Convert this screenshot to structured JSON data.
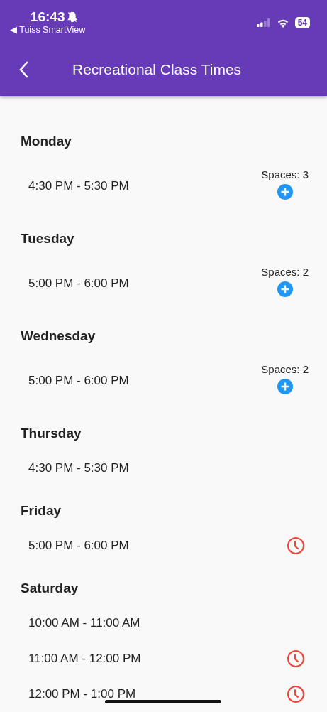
{
  "status_bar": {
    "time": "16:43",
    "back_app": "◀ Tuiss SmartView",
    "battery": "54"
  },
  "app_bar": {
    "title": "Recreational Class Times"
  },
  "days": [
    {
      "name": "Monday",
      "slots": [
        {
          "kind": "spaces",
          "time": "4:30 PM - 5:30 PM",
          "spaces": "Spaces: 3"
        }
      ]
    },
    {
      "name": "Tuesday",
      "slots": [
        {
          "kind": "spaces",
          "time": "5:00 PM - 6:00 PM",
          "spaces": "Spaces: 2"
        }
      ]
    },
    {
      "name": "Wednesday",
      "slots": [
        {
          "kind": "spaces",
          "time": "5:00 PM - 6:00 PM",
          "spaces": "Spaces: 2"
        }
      ]
    },
    {
      "name": "Thursday",
      "slots": [
        {
          "kind": "plain",
          "time": "4:30 PM - 5:30 PM"
        }
      ]
    },
    {
      "name": "Friday",
      "slots": [
        {
          "kind": "waitlist",
          "time": "5:00 PM - 6:00 PM"
        }
      ]
    },
    {
      "name": "Saturday",
      "slots": [
        {
          "kind": "plain",
          "time": "10:00 AM - 11:00 AM"
        },
        {
          "kind": "waitlist",
          "time": "11:00 AM - 12:00 PM"
        },
        {
          "kind": "waitlist",
          "time": "12:00 PM - 1:00 PM"
        }
      ]
    }
  ]
}
